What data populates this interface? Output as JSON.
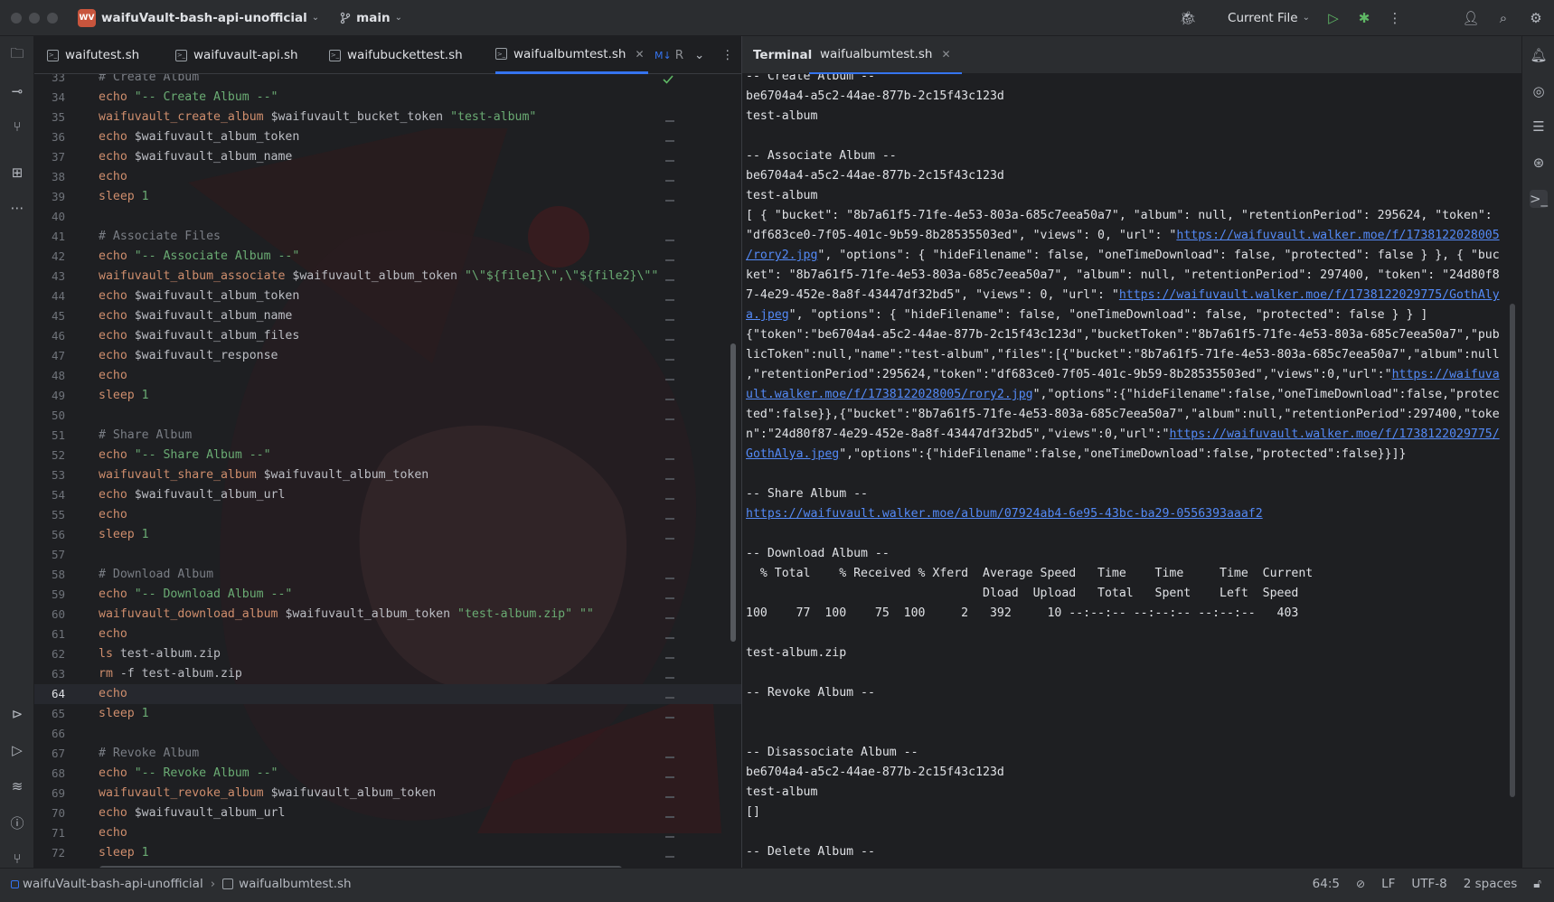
{
  "titlebar": {
    "project_badge": "WV",
    "project_name": "waifuVault-bash-api-unofficial",
    "branch": "main",
    "run_config": "Current File"
  },
  "editor_tabs": [
    {
      "label": "waifutest.sh"
    },
    {
      "label": "waifuvault-api.sh"
    },
    {
      "label": "waifubuckettest.sh"
    },
    {
      "label": "waifualbumtest.sh"
    },
    {
      "label": "R"
    }
  ],
  "terminal_tabs": {
    "terminal": "Terminal",
    "file": "waifualbumtest.sh"
  },
  "editor": {
    "current_line": 64,
    "lines": [
      {
        "n": "33",
        "parts": [
          [
            "cm",
            "# Create Album"
          ]
        ]
      },
      {
        "n": "34",
        "parts": [
          [
            "kw",
            "echo"
          ],
          [
            "st",
            " \"-- Create Album --\""
          ]
        ]
      },
      {
        "n": "35",
        "parts": [
          [
            "fn",
            "waifuvault_create_album"
          ],
          [
            "vr",
            " $waifuvault_bucket_token "
          ],
          [
            "st",
            "\"test-album\""
          ]
        ]
      },
      {
        "n": "36",
        "parts": [
          [
            "kw",
            "echo"
          ],
          [
            "vr",
            " $waifuvault_album_token"
          ]
        ]
      },
      {
        "n": "37",
        "parts": [
          [
            "kw",
            "echo"
          ],
          [
            "vr",
            " $waifuvault_album_name"
          ]
        ]
      },
      {
        "n": "38",
        "parts": [
          [
            "kw",
            "echo"
          ]
        ]
      },
      {
        "n": "39",
        "parts": [
          [
            "kw",
            "sleep"
          ],
          [
            "st",
            " 1"
          ]
        ]
      },
      {
        "n": "40",
        "parts": []
      },
      {
        "n": "41",
        "parts": [
          [
            "cm",
            "# Associate Files"
          ]
        ]
      },
      {
        "n": "42",
        "parts": [
          [
            "kw",
            "echo"
          ],
          [
            "st",
            " \"-- Associate Album --\""
          ]
        ]
      },
      {
        "n": "43",
        "parts": [
          [
            "fn",
            "waifuvault_album_associate"
          ],
          [
            "vr",
            " $waifuvault_album_token "
          ],
          [
            "st",
            "\"\\\"${file1}\\\",\\\"${file2}\\\"\""
          ]
        ]
      },
      {
        "n": "44",
        "parts": [
          [
            "kw",
            "echo"
          ],
          [
            "vr",
            " $waifuvault_album_token"
          ]
        ]
      },
      {
        "n": "45",
        "parts": [
          [
            "kw",
            "echo"
          ],
          [
            "vr",
            " $waifuvault_album_name"
          ]
        ]
      },
      {
        "n": "46",
        "parts": [
          [
            "kw",
            "echo"
          ],
          [
            "vr",
            " $waifuvault_album_files"
          ]
        ]
      },
      {
        "n": "47",
        "parts": [
          [
            "kw",
            "echo"
          ],
          [
            "vr",
            " $waifuvault_response"
          ]
        ]
      },
      {
        "n": "48",
        "parts": [
          [
            "kw",
            "echo"
          ]
        ]
      },
      {
        "n": "49",
        "parts": [
          [
            "kw",
            "sleep"
          ],
          [
            "st",
            " 1"
          ]
        ]
      },
      {
        "n": "50",
        "parts": []
      },
      {
        "n": "51",
        "parts": [
          [
            "cm",
            "# Share Album"
          ]
        ]
      },
      {
        "n": "52",
        "parts": [
          [
            "kw",
            "echo"
          ],
          [
            "st",
            " \"-- Share Album --\""
          ]
        ]
      },
      {
        "n": "53",
        "parts": [
          [
            "fn",
            "waifuvault_share_album"
          ],
          [
            "vr",
            " $waifuvault_album_token"
          ]
        ]
      },
      {
        "n": "54",
        "parts": [
          [
            "kw",
            "echo"
          ],
          [
            "vr",
            " $waifuvault_album_url"
          ]
        ]
      },
      {
        "n": "55",
        "parts": [
          [
            "kw",
            "echo"
          ]
        ]
      },
      {
        "n": "56",
        "parts": [
          [
            "kw",
            "sleep"
          ],
          [
            "st",
            " 1"
          ]
        ]
      },
      {
        "n": "57",
        "parts": []
      },
      {
        "n": "58",
        "parts": [
          [
            "cm",
            "# Download Album"
          ]
        ]
      },
      {
        "n": "59",
        "parts": [
          [
            "kw",
            "echo"
          ],
          [
            "st",
            " \"-- Download Album --\""
          ]
        ]
      },
      {
        "n": "60",
        "parts": [
          [
            "fn",
            "waifuvault_download_album"
          ],
          [
            "vr",
            " $waifuvault_album_token "
          ],
          [
            "st",
            "\"test-album.zip\" \"\""
          ]
        ]
      },
      {
        "n": "61",
        "parts": [
          [
            "kw",
            "echo"
          ]
        ]
      },
      {
        "n": "62",
        "parts": [
          [
            "kw",
            "ls"
          ],
          [
            "vr",
            " test-album.zip"
          ]
        ]
      },
      {
        "n": "63",
        "parts": [
          [
            "kw",
            "rm"
          ],
          [
            "vr",
            " -f test-album.zip"
          ]
        ]
      },
      {
        "n": "64",
        "parts": [
          [
            "kw",
            "echo"
          ]
        ]
      },
      {
        "n": "65",
        "parts": [
          [
            "kw",
            "sleep"
          ],
          [
            "st",
            " 1"
          ]
        ]
      },
      {
        "n": "66",
        "parts": []
      },
      {
        "n": "67",
        "parts": [
          [
            "cm",
            "# Revoke Album"
          ]
        ]
      },
      {
        "n": "68",
        "parts": [
          [
            "kw",
            "echo"
          ],
          [
            "st",
            " \"-- Revoke Album --\""
          ]
        ]
      },
      {
        "n": "69",
        "parts": [
          [
            "fn",
            "waifuvault_revoke_album"
          ],
          [
            "vr",
            " $waifuvault_album_token"
          ]
        ]
      },
      {
        "n": "70",
        "parts": [
          [
            "kw",
            "echo"
          ],
          [
            "vr",
            " $waifuvault_album_url"
          ]
        ]
      },
      {
        "n": "71",
        "parts": [
          [
            "kw",
            "echo"
          ]
        ]
      },
      {
        "n": "72",
        "parts": [
          [
            "kw",
            "sleep"
          ],
          [
            "st",
            " 1"
          ]
        ]
      }
    ]
  },
  "terminal": {
    "lines": [
      [
        [
          "t",
          "-- Create Album --"
        ]
      ],
      [
        [
          "t",
          "be6704a4-a5c2-44ae-877b-2c15f43c123d"
        ]
      ],
      [
        [
          "t",
          "test-album"
        ]
      ],
      [],
      [
        [
          "t",
          "-- Associate Album --"
        ]
      ],
      [
        [
          "t",
          "be6704a4-a5c2-44ae-877b-2c15f43c123d"
        ]
      ],
      [
        [
          "t",
          "test-album"
        ]
      ],
      [
        [
          "t",
          "[ { \"bucket\": \"8b7a61f5-71fe-4e53-803a-685c7eea50a7\", \"album\": null, \"retentionPeriod\": 295624, \"token\":"
        ]
      ],
      [
        [
          "t",
          "\"df683ce0-7f05-401c-9b59-8b28535503ed\", \"views\": 0, \"url\": \""
        ],
        [
          "l",
          "https://waifuvault.walker.moe/f/1738122028005"
        ]
      ],
      [
        [
          "l",
          "/rory2.jpg"
        ],
        [
          "t",
          "\", \"options\": { \"hideFilename\": false, \"oneTimeDownload\": false, \"protected\": false } }, { \"buc"
        ]
      ],
      [
        [
          "t",
          "ket\": \"8b7a61f5-71fe-4e53-803a-685c7eea50a7\", \"album\": null, \"retentionPeriod\": 297400, \"token\": \"24d80f8"
        ]
      ],
      [
        [
          "t",
          "7-4e29-452e-8a8f-43447df32bd5\", \"views\": 0, \"url\": \""
        ],
        [
          "l",
          "https://waifuvault.walker.moe/f/1738122029775/GothAly"
        ]
      ],
      [
        [
          "l",
          "a.jpeg"
        ],
        [
          "t",
          "\", \"options\": { \"hideFilename\": false, \"oneTimeDownload\": false, \"protected\": false } } ]"
        ]
      ],
      [
        [
          "t",
          "{\"token\":\"be6704a4-a5c2-44ae-877b-2c15f43c123d\",\"bucketToken\":\"8b7a61f5-71fe-4e53-803a-685c7eea50a7\",\"pub"
        ]
      ],
      [
        [
          "t",
          "licToken\":null,\"name\":\"test-album\",\"files\":[{\"bucket\":\"8b7a61f5-71fe-4e53-803a-685c7eea50a7\",\"album\":null"
        ]
      ],
      [
        [
          "t",
          ",\"retentionPeriod\":295624,\"token\":\"df683ce0-7f05-401c-9b59-8b28535503ed\",\"views\":0,\"url\":\""
        ],
        [
          "l",
          "https://waifuva"
        ]
      ],
      [
        [
          "l",
          "ult.walker.moe/f/1738122028005/rory2.jpg"
        ],
        [
          "t",
          "\",\"options\":{\"hideFilename\":false,\"oneTimeDownload\":false,\"protec"
        ]
      ],
      [
        [
          "t",
          "ted\":false}},{\"bucket\":\"8b7a61f5-71fe-4e53-803a-685c7eea50a7\",\"album\":null,\"retentionPeriod\":297400,\"toke"
        ]
      ],
      [
        [
          "t",
          "n\":\"24d80f87-4e29-452e-8a8f-43447df32bd5\",\"views\":0,\"url\":\""
        ],
        [
          "l",
          "https://waifuvault.walker.moe/f/1738122029775/"
        ]
      ],
      [
        [
          "l",
          "GothAlya.jpeg"
        ],
        [
          "t",
          "\",\"options\":{\"hideFilename\":false,\"oneTimeDownload\":false,\"protected\":false}}]}"
        ]
      ],
      [],
      [
        [
          "t",
          "-- Share Album --"
        ]
      ],
      [
        [
          "l",
          "https://waifuvault.walker.moe/album/07924ab4-6e95-43bc-ba29-0556393aaaf2"
        ]
      ],
      [],
      [
        [
          "t",
          "-- Download Album --"
        ]
      ],
      [
        [
          "t",
          "  % Total    % Received % Xferd  Average Speed   Time    Time     Time  Current"
        ]
      ],
      [
        [
          "t",
          "                                 Dload  Upload   Total   Spent    Left  Speed"
        ]
      ],
      [
        [
          "t",
          "100    77  100    75  100     2   392     10 --:--:-- --:--:-- --:--:--   403"
        ]
      ],
      [],
      [
        [
          "t",
          "test-album.zip"
        ]
      ],
      [],
      [
        [
          "t",
          "-- Revoke Album --"
        ]
      ],
      [],
      [],
      [
        [
          "t",
          "-- Disassociate Album --"
        ]
      ],
      [
        [
          "t",
          "be6704a4-a5c2-44ae-877b-2c15f43c123d"
        ]
      ],
      [
        [
          "t",
          "test-album"
        ]
      ],
      [
        [
          "t",
          "[]"
        ]
      ],
      [],
      [
        [
          "t",
          "-- Delete Album --"
        ]
      ]
    ]
  },
  "statusbar": {
    "project": "waifuVault-bash-api-unofficial",
    "file": "waifualbumtest.sh",
    "position": "64:5",
    "line_ending": "LF",
    "encoding": "UTF-8",
    "indent": "2 spaces"
  },
  "colors": {
    "accent": "#3574f0",
    "link": "#548af7",
    "keyword": "#cf8e6d",
    "string": "#6aab73",
    "comment": "#7a7e85"
  }
}
